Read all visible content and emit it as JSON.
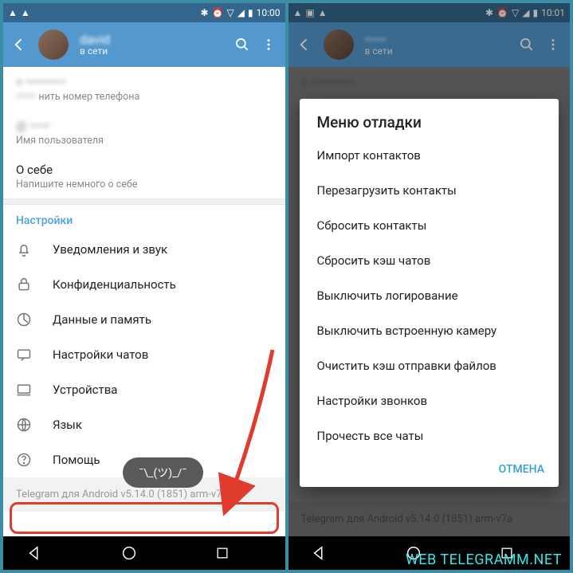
{
  "left": {
    "status": {
      "time": "10:00"
    },
    "header": {
      "name": "david",
      "sub": "в сети"
    },
    "profile": {
      "phone_label": "нить номер телефона",
      "username_label": "Имя пользователя",
      "about_title": "О себе",
      "about_hint": "Напишите немного о себе"
    },
    "settings_title": "Настройки",
    "settings": [
      {
        "icon": "bell-icon",
        "label": "Уведомления и звук"
      },
      {
        "icon": "lock-icon",
        "label": "Конфиденциальность"
      },
      {
        "icon": "data-icon",
        "label": "Данные и память"
      },
      {
        "icon": "chat-icon",
        "label": "Настройки чатов"
      },
      {
        "icon": "device-icon",
        "label": "Устройства"
      },
      {
        "icon": "globe-icon",
        "label": "Язык"
      },
      {
        "icon": "help-icon",
        "label": "Помощь"
      }
    ],
    "toast": "¯\\_(ツ)_/¯",
    "version": "Telegram для Android v5.14.0 (1851) arm-v7a"
  },
  "right": {
    "status": {
      "time": "10:01"
    },
    "header": {
      "sub": "в сети"
    },
    "dialog": {
      "title": "Меню отладки",
      "items": [
        "Импорт контактов",
        "Перезагрузить контакты",
        "Сбросить контакты",
        "Сбросить кэш чатов",
        "Выключить логирование",
        "Выключить встроенную камеру",
        "Очистить кэш отправки файлов",
        "Настройки звонков",
        "Прочесть все чаты"
      ],
      "cancel": "ОТМЕНА"
    },
    "version": "Telegram для Android v5.14.0 (1851) arm-v7a"
  },
  "watermark": "WEB TELEGRAMM.NET"
}
